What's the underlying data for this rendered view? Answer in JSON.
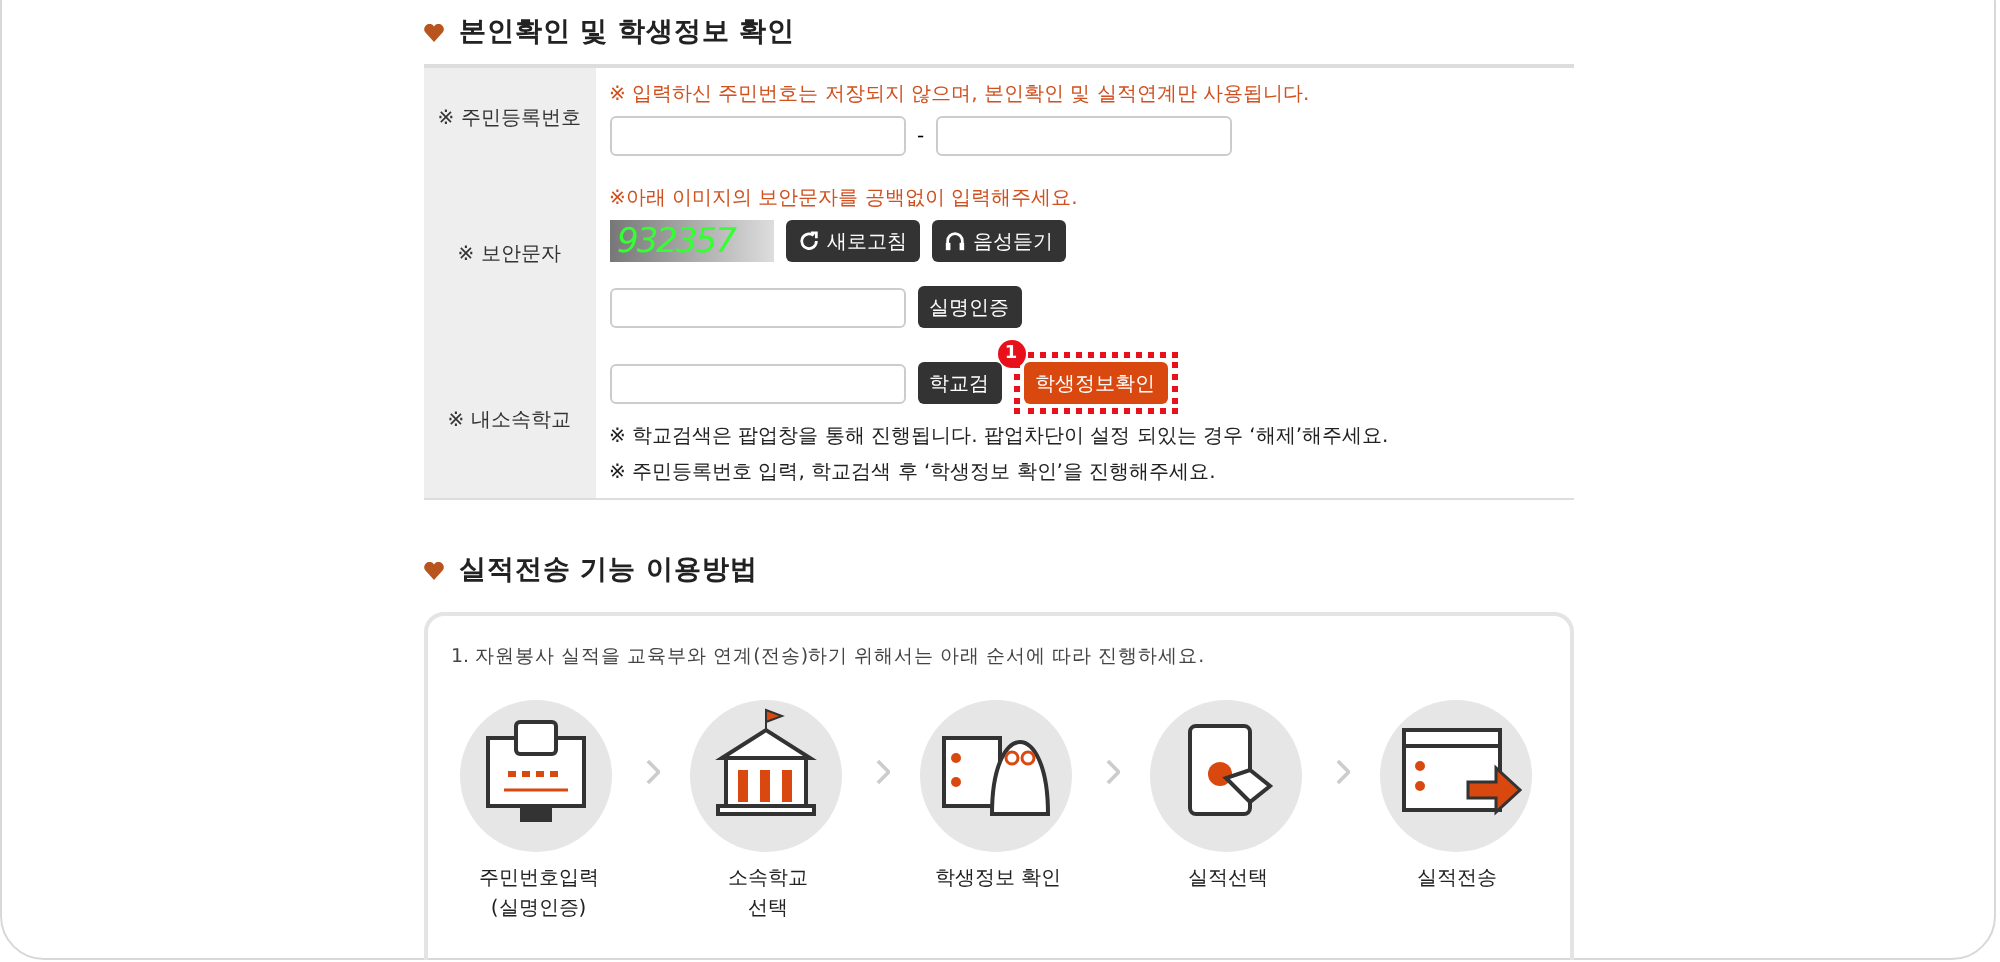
{
  "identity_section": {
    "title": "본인확인 및 학생정보 확인",
    "ssn_row": {
      "label": "※ 주민등록번호",
      "notice": "※ 입력하신 주민번호는 저장되지 않으며, 본인확인 및 실적연계만 사용됩니다.",
      "separator": "-"
    },
    "captcha_row": {
      "label": "※ 보안문자",
      "notice": "※아래 이미지의 보안문자를 공백없이 입력해주세요.",
      "captcha_text": "932357",
      "refresh_button": "새로고침",
      "audio_button": "음성듣기",
      "verify_button": "실명인증"
    },
    "school_row": {
      "label": "※ 내소속학교",
      "search_button": "학교검",
      "badge": "1",
      "confirm_button": "학생정보확인",
      "confirm_highlighted": true,
      "notes": [
        "※ 학교검색은 팝업창을 통해 진행됩니다. 팝업차단이 설정 되있는 경우 ‘해제’해주세요.",
        "※ 주민등록번호 입력, 학교검색 후 ‘학생정보 확인’을 진행해주세요."
      ]
    }
  },
  "howto_section": {
    "title": "실적전송 기능 이용방법",
    "intro": "1. 자원봉사 실적을 교육부와 연계(전송)하기 위해서는 아래 순서에 따라 진행하세요.",
    "steps": [
      {
        "kind": "monitor",
        "label": "주민번호입력\n(실명인증)"
      },
      {
        "kind": "school",
        "label": "소속학교\n선택"
      },
      {
        "kind": "student",
        "label": "학생정보 확인"
      },
      {
        "kind": "tablet",
        "label": "실적선택"
      },
      {
        "kind": "send",
        "label": "실적전송"
      }
    ]
  }
}
